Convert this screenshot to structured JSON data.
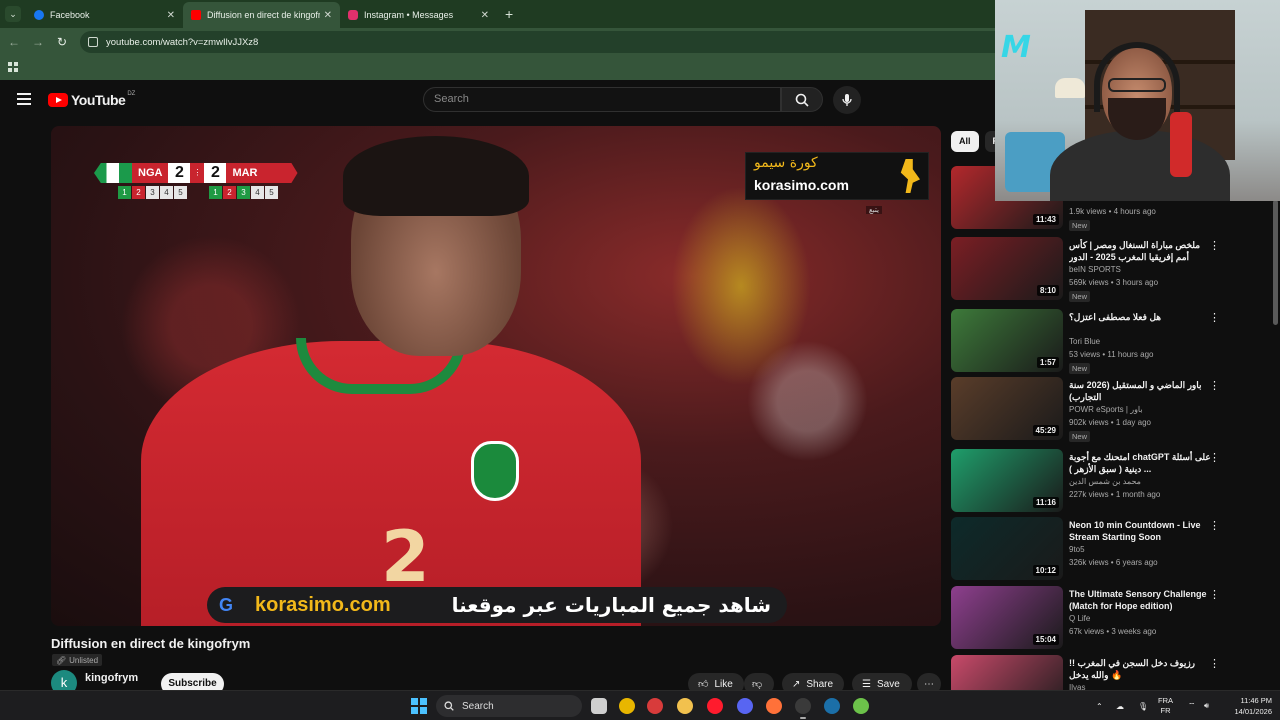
{
  "browser": {
    "tabs": [
      {
        "title": "Facebook",
        "favicon_color": "#1877f2",
        "active": false
      },
      {
        "title": "Diffusion en direct de kingofrym",
        "favicon_color": "#ff0000",
        "active": true
      },
      {
        "title": "Instagram • Messages",
        "favicon_color": "#e1306c",
        "active": false
      }
    ],
    "url": "youtube.com/watch?v=zmwIlvJJXz8"
  },
  "youtube": {
    "logo_text": "YouTube",
    "country_code": "DZ",
    "search_placeholder": "Search"
  },
  "video": {
    "overlay": {
      "home_team": "NGA",
      "away_team": "MAR",
      "home_score": "2",
      "away_score": "2",
      "home_pens": [
        "1",
        "2",
        "3",
        "4",
        "5"
      ],
      "away_pens": [
        "1",
        "2",
        "3",
        "4",
        "5"
      ],
      "brand_ar": "كورة سيمو",
      "brand_en": "korasimo.com",
      "brand_sub": "يتبع",
      "banner_g": "G",
      "banner_url": "korasimo.com",
      "banner_ar": "شاهد جميع المباريات عبر موقعنا"
    },
    "title": "Diffusion en direct de kingofrym",
    "visibility": "Unlisted",
    "channel_initial": "k",
    "channel_name": "kingofrym",
    "subscribe_label": "Subscribe",
    "actions": {
      "like": "Like",
      "share": "Share",
      "save": "Save"
    }
  },
  "sidebar": {
    "chips": [
      "All",
      "F"
    ],
    "recommendations": [
      {
        "title": "",
        "channel": "",
        "meta": "1.9k views • 4 hours ago",
        "badge": "New",
        "duration": "11:43",
        "thumb": "#b3282c"
      },
      {
        "title": "ملخص مباراة السنغال ومصر | كأس أمم إفريقيا المغرب 2025 - الدور نصف النهائي",
        "channel": "beIN SPORTS",
        "meta": "569k views • 3 hours ago",
        "badge": "New",
        "duration": "8:10",
        "thumb": "#7b1e24"
      },
      {
        "title": "هل فعلا مصطفى اعتزل؟",
        "channel": "Tori Blue",
        "meta": "53 views • 11 hours ago",
        "badge": "New",
        "duration": "1:57",
        "thumb": "#3d7a3a"
      },
      {
        "title": "باور الماضي و المستقبل (2026 سنة التجارب)",
        "channel": "POWR eSports | باور",
        "meta": "902k views • 1 day ago",
        "badge": "New",
        "duration": "45:29",
        "thumb": "#5a3d2a"
      },
      {
        "title": "امتحنك مع أجوبة chatGPT على أسئلة دينية ( سبق الأزهر ) ...",
        "channel": "محمد بن شمس الدين",
        "meta": "227k views • 1 month ago",
        "badge": "",
        "duration": "11:16",
        "thumb": "#1f9e6b"
      },
      {
        "title": "Neon 10 min Countdown - Live Stream Starting Soon",
        "channel": "9to5",
        "meta": "326k views • 6 years ago",
        "badge": "",
        "duration": "10:12",
        "thumb": "#0d2a2a"
      },
      {
        "title": "The Ultimate Sensory Challenge (Match for Hope edition)",
        "channel": "Q Life",
        "meta": "67k views • 3 weeks ago",
        "badge": "",
        "duration": "15:04",
        "thumb": "#8e3f8e"
      },
      {
        "title": "رزيوف دخل السجن في المغرب !! والله يدخل 🔥",
        "channel": "Ilyas",
        "meta": "",
        "badge": "",
        "duration": "",
        "thumb": "#c94a6a"
      }
    ]
  },
  "webcam": {
    "logo": "M"
  },
  "taskbar": {
    "search_label": "Search",
    "lang_top": "FRA",
    "lang_bottom": "FR",
    "time": "11:46 PM",
    "date": "14/01/2026",
    "apps": [
      {
        "name": "task-view",
        "color": "#cfcfcf"
      },
      {
        "name": "chrome",
        "color": "#e8b600"
      },
      {
        "name": "app-red",
        "color": "#d83b3b"
      },
      {
        "name": "file-explorer",
        "color": "#f2c14e"
      },
      {
        "name": "opera",
        "color": "#ff1b2d"
      },
      {
        "name": "discord",
        "color": "#5865f2"
      },
      {
        "name": "firefox",
        "color": "#ff7139"
      },
      {
        "name": "obs",
        "color": "#3a3a3a"
      },
      {
        "name": "steam",
        "color": "#1b6fa8"
      },
      {
        "name": "utorrent",
        "color": "#6cc24a"
      }
    ]
  }
}
